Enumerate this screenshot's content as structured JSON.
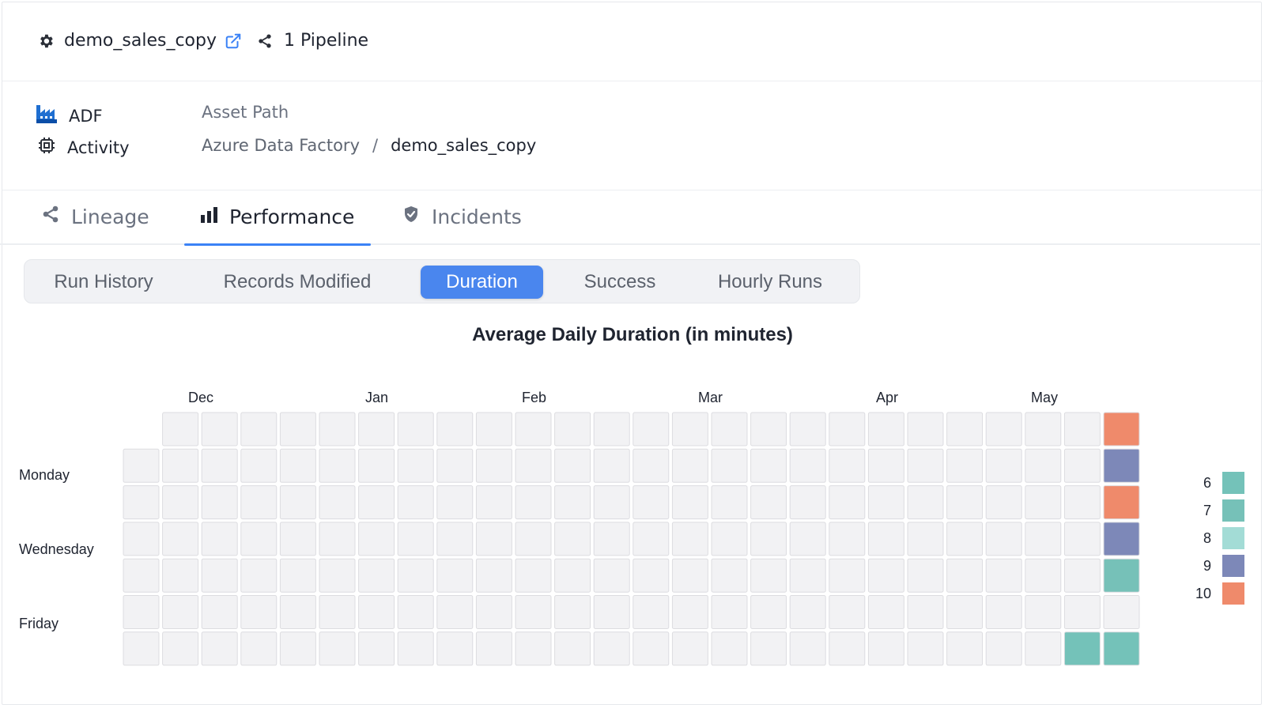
{
  "header": {
    "asset_name": "demo_sales_copy",
    "pipeline_count": "1 Pipeline"
  },
  "meta": {
    "platform": "ADF",
    "asset_type": "Activity",
    "asset_path_label": "Asset Path",
    "path": [
      "Azure Data Factory",
      "demo_sales_copy"
    ],
    "separator": "/"
  },
  "tabs": [
    {
      "label": "Lineage",
      "active": false,
      "icon": "share-icon"
    },
    {
      "label": "Performance",
      "active": true,
      "icon": "bar-chart-icon"
    },
    {
      "label": "Incidents",
      "active": false,
      "icon": "shield-check-icon"
    }
  ],
  "subtabs": [
    {
      "label": "Run History",
      "active": false
    },
    {
      "label": "Records Modified",
      "active": false
    },
    {
      "label": "Duration",
      "active": true
    },
    {
      "label": "Success",
      "active": false
    },
    {
      "label": "Hourly Runs",
      "active": false
    }
  ],
  "accent_color": "#4a86ee",
  "chart_data": {
    "type": "heatmap",
    "title": "Average Daily Duration (in minutes)",
    "months": [
      "Dec",
      "Jan",
      "Feb",
      "Mar",
      "Apr",
      "May"
    ],
    "day_labels": [
      "Monday",
      "Wednesday",
      "Friday"
    ],
    "weeks": 26,
    "empty_color": "#f2f2f4",
    "first_week_start_row": 1,
    "values": [
      {
        "week": 24,
        "day": 6,
        "value": 6
      },
      {
        "week": 25,
        "day": 0,
        "value": 10
      },
      {
        "week": 25,
        "day": 1,
        "value": 9
      },
      {
        "week": 25,
        "day": 2,
        "value": 10
      },
      {
        "week": 25,
        "day": 3,
        "value": 9
      },
      {
        "week": 25,
        "day": 4,
        "value": 7
      },
      {
        "week": 25,
        "day": 6,
        "value": 6
      }
    ],
    "legend": [
      {
        "value": "6",
        "color": "#74c2b9"
      },
      {
        "value": "7",
        "color": "#76c1b8"
      },
      {
        "value": "8",
        "color": "#a3dcd6"
      },
      {
        "value": "9",
        "color": "#7d88b8"
      },
      {
        "value": "10",
        "color": "#ef8a6b"
      }
    ]
  }
}
